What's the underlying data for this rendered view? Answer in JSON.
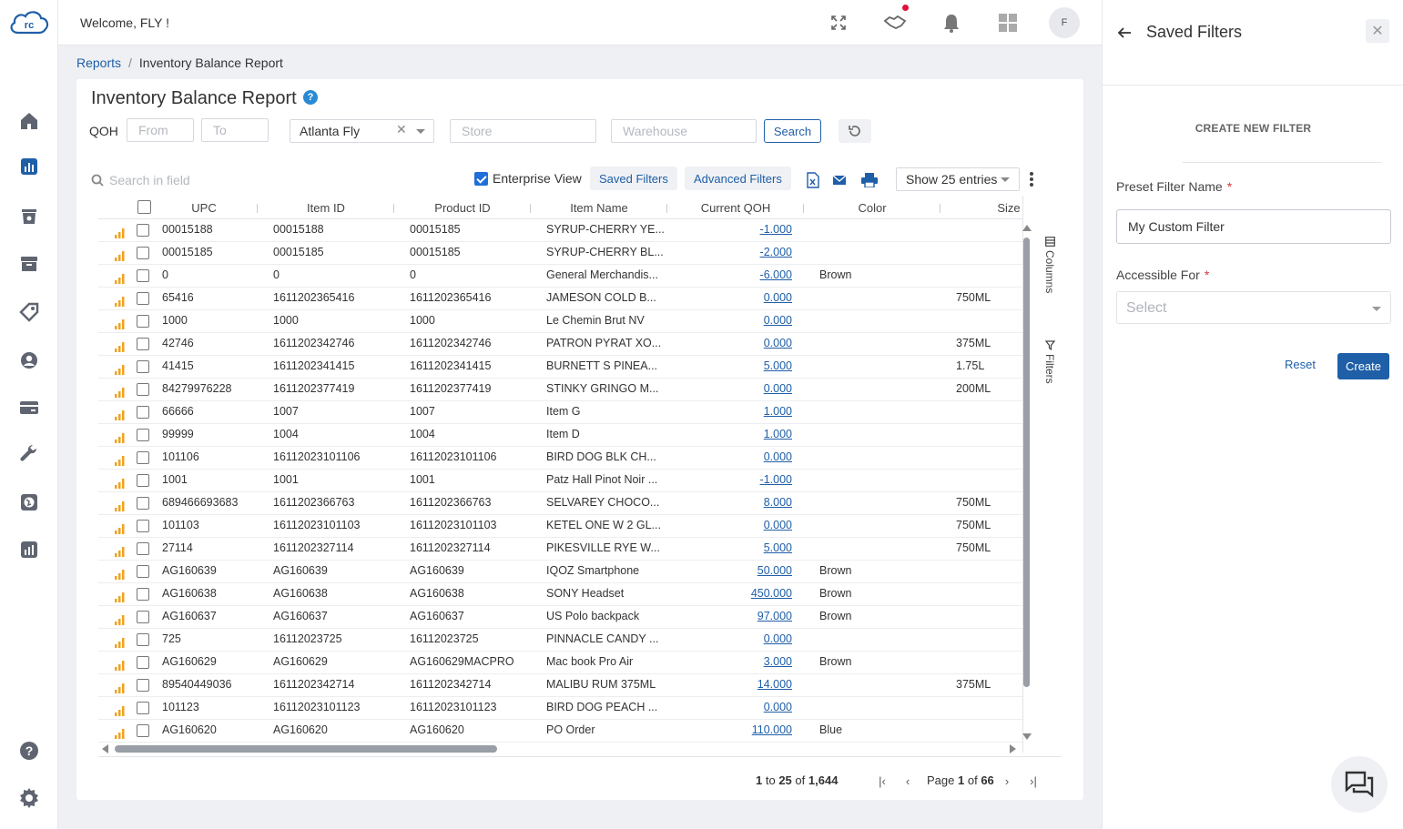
{
  "app": {
    "logo_text": "rc",
    "welcome": "Welcome, FLY !",
    "avatar_initial": "F"
  },
  "breadcrumb": {
    "parent": "Reports",
    "current": "Inventory Balance Report"
  },
  "report": {
    "title": "Inventory Balance Report",
    "help_glyph": "?",
    "qoh_label": "QOH",
    "from_placeholder": "From",
    "to_placeholder": "To",
    "location_value": "Atlanta Fly",
    "store_placeholder": "Store",
    "warehouse_placeholder": "Warehouse",
    "search_button": "Search",
    "search_field_placeholder": "Search in field",
    "enterprise_view_label": "Enterprise View",
    "saved_filters_label": "Saved Filters",
    "advanced_filters_label": "Advanced Filters",
    "show_entries": "Show 25 entries",
    "columns_tab": "Columns",
    "filters_tab": "Filters"
  },
  "table": {
    "headers": [
      "UPC",
      "Item ID",
      "Product ID",
      "Item Name",
      "Current QOH",
      "Color",
      "Size"
    ],
    "rows": [
      [
        "00015188",
        "00015188",
        "00015185",
        "SYRUP-CHERRY YE...",
        "-1.000",
        "",
        ""
      ],
      [
        "00015185",
        "00015185",
        "00015185",
        "SYRUP-CHERRY BL...",
        "-2.000",
        "",
        ""
      ],
      [
        "0",
        "0",
        "0",
        "General Merchandis...",
        "-6.000",
        "Brown",
        ""
      ],
      [
        "65416",
        "1611202365416",
        "1611202365416",
        "JAMESON COLD B...",
        "0.000",
        "",
        "750ML"
      ],
      [
        "1000",
        "1000",
        "1000",
        "Le Chemin Brut NV",
        "0.000",
        "",
        ""
      ],
      [
        "42746",
        "1611202342746",
        "1611202342746",
        "PATRON PYRAT XO...",
        "0.000",
        "",
        "375ML"
      ],
      [
        "41415",
        "1611202341415",
        "1611202341415",
        "BURNETT S PINEA...",
        "5.000",
        "",
        "1.75L"
      ],
      [
        "84279976228",
        "1611202377419",
        "1611202377419",
        "STINKY GRINGO M...",
        "0.000",
        "",
        "200ML"
      ],
      [
        "66666",
        "1007",
        "1007",
        "Item G",
        "1.000",
        "",
        ""
      ],
      [
        "99999",
        "1004",
        "1004",
        "Item D",
        "1.000",
        "",
        ""
      ],
      [
        "101106",
        "16112023101106",
        "16112023101106",
        "BIRD DOG BLK CH...",
        "0.000",
        "",
        ""
      ],
      [
        "1001",
        "1001",
        "1001",
        "Patz Hall Pinot Noir ...",
        "-1.000",
        "",
        ""
      ],
      [
        "689466693683",
        "1611202366763",
        "1611202366763",
        "SELVAREY CHOCO...",
        "8.000",
        "",
        "750ML"
      ],
      [
        "101103",
        "16112023101103",
        "16112023101103",
        "KETEL ONE W 2 GL...",
        "0.000",
        "",
        "750ML"
      ],
      [
        "27114",
        "1611202327114",
        "1611202327114",
        "PIKESVILLE RYE W...",
        "5.000",
        "",
        "750ML"
      ],
      [
        "AG160639",
        "AG160639",
        "AG160639",
        "IQOZ Smartphone",
        "50.000",
        "Brown",
        ""
      ],
      [
        "AG160638",
        "AG160638",
        "AG160638",
        "SONY Headset",
        "450.000",
        "Brown",
        ""
      ],
      [
        "AG160637",
        "AG160637",
        "AG160637",
        "US Polo backpack",
        "97.000",
        "Brown",
        ""
      ],
      [
        "725",
        "16112023725",
        "16112023725",
        "PINNACLE CANDY ...",
        "0.000",
        "",
        ""
      ],
      [
        "AG160629",
        "AG160629",
        "AG160629MACPRO",
        "Mac book Pro Air",
        "3.000",
        "Brown",
        ""
      ],
      [
        "89540449036",
        "1611202342714",
        "1611202342714",
        "MALIBU RUM 375ML",
        "14.000",
        "",
        "375ML"
      ],
      [
        "101123",
        "16112023101123",
        "16112023101123",
        "BIRD DOG PEACH ...",
        "0.000",
        "",
        ""
      ],
      [
        "AG160620",
        "AG160620",
        "AG160620",
        "PO Order",
        "110.000",
        "Blue",
        ""
      ]
    ]
  },
  "pagination": {
    "range_from": "1",
    "range_to_word": "to",
    "range_to": "25",
    "of_word": "of",
    "total": "1,644",
    "page_word": "Page",
    "page": "1",
    "page_of_word": "of",
    "page_count": "66"
  },
  "panel": {
    "title": "Saved Filters",
    "close_glyph": "✕",
    "create_title": "CREATE NEW FILTER",
    "preset_label": "Preset Filter Name",
    "required_mark": "*",
    "preset_value": "My Custom Filter",
    "accessible_label": "Accessible For",
    "accessible_placeholder": "Select",
    "reset_label": "Reset",
    "create_label": "Create"
  },
  "icons": {
    "nav": [
      "home-icon",
      "reports-icon",
      "inventory-icon",
      "archive-icon",
      "tag-icon",
      "customer-icon",
      "payments-icon",
      "tools-icon",
      "globe-icon",
      "analytics-icon",
      "help-icon",
      "settings-icon"
    ],
    "top": [
      "fullscreen-icon",
      "handshake-icon",
      "bell-icon",
      "apps-grid-icon"
    ]
  },
  "colors": {
    "accent": "#1f5fa8",
    "bars": "#f0a21e",
    "badge": "#e0103a",
    "primary_button": "#1f5fa8"
  }
}
